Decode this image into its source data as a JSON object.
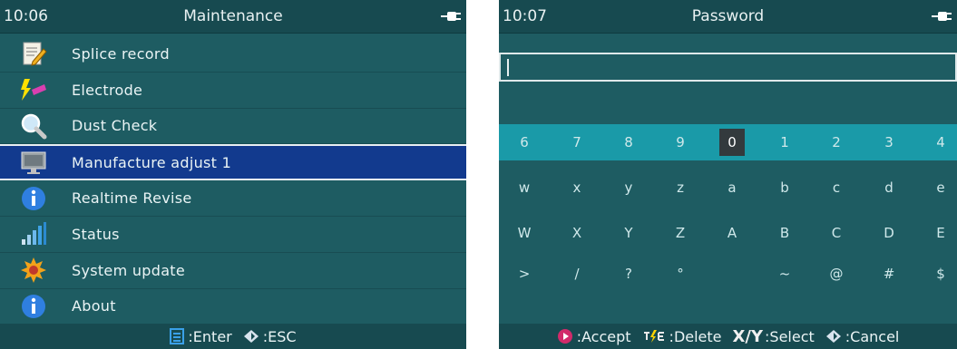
{
  "left": {
    "time": "10:06",
    "title": "Maintenance",
    "menu": [
      {
        "label": "Splice record",
        "icon": "notepad-icon"
      },
      {
        "label": "Electrode",
        "icon": "electrode-icon"
      },
      {
        "label": "Dust Check",
        "icon": "magnifier-icon"
      },
      {
        "label": "Manufacture adjust 1",
        "icon": "monitor-icon",
        "selected": true
      },
      {
        "label": "Realtime Revise",
        "icon": "info-icon"
      },
      {
        "label": "Status",
        "icon": "signal-bars-icon"
      },
      {
        "label": "System update",
        "icon": "gear-burst-icon"
      },
      {
        "label": "About",
        "icon": "info-icon"
      }
    ],
    "footer": {
      "enter": ":Enter",
      "esc": ":ESC"
    }
  },
  "right": {
    "time": "10:07",
    "title": "Password",
    "password_value": "",
    "keyboard": [
      [
        "6",
        "7",
        "8",
        "9",
        "0",
        "1",
        "2",
        "3",
        "4"
      ],
      [
        "w",
        "x",
        "y",
        "z",
        "a",
        "b",
        "c",
        "d",
        "e"
      ],
      [
        "W",
        "X",
        "Y",
        "Z",
        "A",
        "B",
        "C",
        "D",
        "E"
      ],
      [
        ">",
        "/",
        "?",
        "°",
        "",
        "~",
        "@",
        "#",
        "$"
      ]
    ],
    "selected_key": "0",
    "footer": {
      "accept": ":Accept",
      "delete": ":Delete",
      "select_glyph": "X/Y",
      "select": ":Select",
      "cancel": ":Cancel"
    }
  },
  "colors": {
    "screen_bg": "#1e5c62",
    "bar_bg": "#174a50",
    "selected": "#123a8e",
    "keyboard_row": "#1a9aa8"
  }
}
